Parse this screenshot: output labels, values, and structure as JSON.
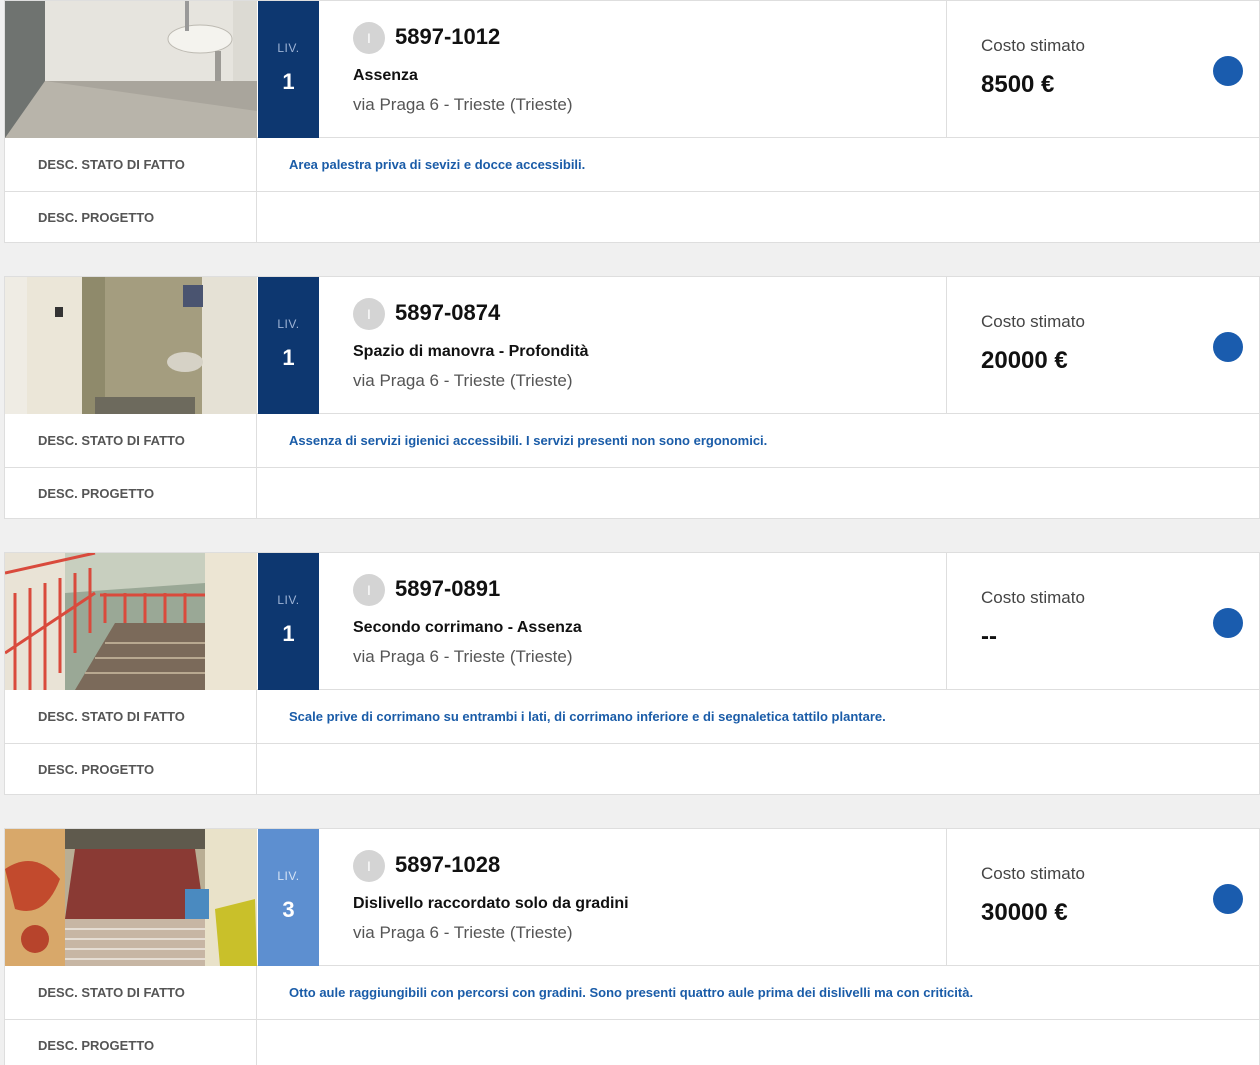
{
  "labels": {
    "level": "LIV.",
    "cost": "Costo stimato",
    "stato": "DESC. STATO DI FATTO",
    "progetto": "DESC. PROGETTO",
    "badge": "I"
  },
  "colors": {
    "level_dark": "#0d3770",
    "level_light": "#5d8fd0",
    "dot": "#1a5cae",
    "link_text": "#1a5ca8"
  },
  "items": [
    {
      "level": "1",
      "code": "5897-1012",
      "title": "Assenza",
      "address": "via Praga 6 - Trieste (Trieste)",
      "cost": "8500 €",
      "stato": "Area palestra priva di sevizi e docce accessibili.",
      "progetto": ""
    },
    {
      "level": "1",
      "code": "5897-0874",
      "title": "Spazio di manovra - Profondità",
      "address": "via Praga 6 - Trieste (Trieste)",
      "cost": "20000 €",
      "stato": "Assenza di servizi igienici accessibili. I servizi presenti non sono ergonomici.",
      "progetto": ""
    },
    {
      "level": "1",
      "code": "5897-0891",
      "title": "Secondo corrimano - Assenza",
      "address": "via Praga 6 - Trieste (Trieste)",
      "cost": "--",
      "stato": "Scale prive di corrimano su entrambi i lati, di corrimano inferiore e di segnaletica tattilo plantare.",
      "progetto": ""
    },
    {
      "level": "3",
      "code": "5897-1028",
      "title": "Dislivello raccordato solo da gradini",
      "address": "via Praga 6 - Trieste (Trieste)",
      "cost": "30000 €",
      "stato": "Otto aule raggiungibili con percorsi con gradini. Sono presenti quattro aule prima dei dislivelli ma con criticità.",
      "progetto": ""
    }
  ]
}
